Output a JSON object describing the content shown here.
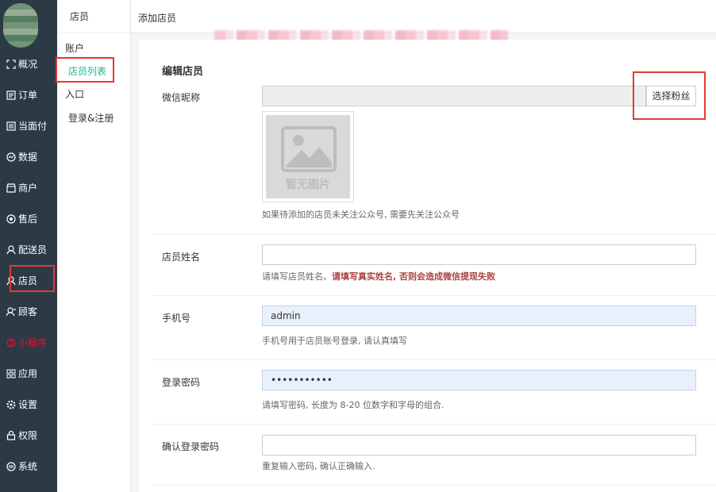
{
  "nav": {
    "items": [
      {
        "label": "概况",
        "icon": "overview-icon"
      },
      {
        "label": "订单",
        "icon": "order-icon"
      },
      {
        "label": "当面付",
        "icon": "pay-icon"
      },
      {
        "label": "数据",
        "icon": "chart-icon"
      },
      {
        "label": "商户",
        "icon": "store-icon"
      },
      {
        "label": "售后",
        "icon": "aftersale-icon"
      },
      {
        "label": "配送员",
        "icon": "courier-icon"
      },
      {
        "label": "店员",
        "icon": "clerk-icon"
      },
      {
        "label": "顾客",
        "icon": "customer-icon"
      },
      {
        "label": "小程序",
        "icon": "miniprogram-icon"
      },
      {
        "label": "应用",
        "icon": "apps-icon"
      },
      {
        "label": "设置",
        "icon": "settings-icon"
      },
      {
        "label": "权限",
        "icon": "lock-icon"
      },
      {
        "label": "系统",
        "icon": "system-icon"
      }
    ]
  },
  "subnav": {
    "header": "店员",
    "items": [
      "账户",
      "店员列表",
      "入口",
      "登录&注册"
    ]
  },
  "topbar": {
    "title": "添加店员"
  },
  "form": {
    "section_title": "编辑店员",
    "wechat": {
      "label": "微信昵称",
      "value": "",
      "button": "选择粉丝",
      "no_image": "暂无图片",
      "help": "如果待添加的店员未关注公众号, 需要先关注公众号"
    },
    "name": {
      "label": "店员姓名",
      "value": "",
      "help_prefix": "请填写店员姓名。",
      "help_strong": "请填写真实姓名, 否则会造成微信提现失败"
    },
    "phone": {
      "label": "手机号",
      "value": "admin",
      "help": "手机号用于店员账号登录, 请认真填写"
    },
    "password": {
      "label": "登录密码",
      "value": "•••••••••••",
      "help": "请填写密码, 长度为 8-20 位数字和字母的组合."
    },
    "confirm_password": {
      "label": "确认登录密码",
      "value": "",
      "help": "重复输入密码, 确认正确输入."
    }
  },
  "colors": {
    "nav_bg": "#2b3a45",
    "active_green": "#1ab394",
    "highlight_red": "#e53935",
    "danger_text": "#a94442"
  }
}
